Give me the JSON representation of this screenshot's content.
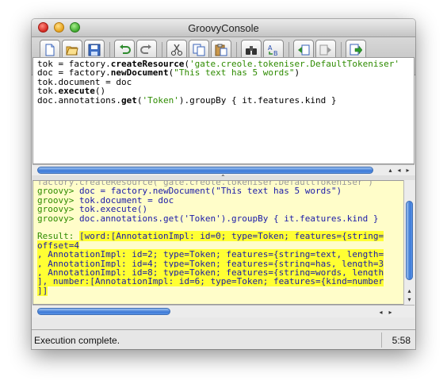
{
  "window": {
    "title": "GroovyConsole"
  },
  "toolbar": {
    "buttons": [
      {
        "name": "new-file-button",
        "icon": "new-file-icon"
      },
      {
        "name": "open-button",
        "icon": "open-folder-icon"
      },
      {
        "name": "save-button",
        "icon": "save-icon"
      },
      {
        "name": "undo-button",
        "icon": "undo-icon"
      },
      {
        "name": "redo-button",
        "icon": "redo-icon"
      },
      {
        "name": "cut-button",
        "icon": "cut-icon"
      },
      {
        "name": "copy-button",
        "icon": "copy-icon"
      },
      {
        "name": "paste-button",
        "icon": "paste-icon"
      },
      {
        "name": "find-button",
        "icon": "binoculars-icon"
      },
      {
        "name": "replace-button",
        "icon": "replace-icon"
      },
      {
        "name": "history-previous-button",
        "icon": "history-previous-icon"
      },
      {
        "name": "history-next-button",
        "icon": "history-next-icon"
      },
      {
        "name": "execute-button",
        "icon": "execute-icon"
      }
    ]
  },
  "editor": {
    "lines": [
      {
        "pre": "tok = factory.",
        "kw": "createResource",
        "post1": "(",
        "str": "'gate.creole.tokeniser.DefaultTokeniser'",
        "post2": ""
      },
      {
        "pre": "doc = factory.",
        "kw": "newDocument",
        "post1": "(",
        "str": "\"This text has 5 words\"",
        "post2": ")"
      },
      {
        "pre": "tok.document = doc",
        "kw": "",
        "post1": "",
        "str": "",
        "post2": ""
      },
      {
        "pre": "tok.",
        "kw": "execute",
        "post1": "()",
        "str": "",
        "post2": ""
      },
      {
        "pre": "doc.annotations.",
        "kw": "get",
        "post1": "(",
        "str": "'Token'",
        "post2": ").groupBy { it.features.kind }"
      }
    ]
  },
  "output": {
    "clipped_line": "factory.createResource('gate.creole.tokeniser.DefaultTokeniser')",
    "prompt": "groovy>",
    "commands": [
      "doc = factory.newDocument(\"This text has 5 words\")",
      "tok.document = doc",
      "tok.execute()",
      "doc.annotations.get('Token').groupBy { it.features.kind }"
    ],
    "result_label": "Result:",
    "result_lines": [
      "[word:[AnnotationImpl: id=0; type=Token; features={string=",
      "offset=4",
      ", AnnotationImpl: id=2; type=Token; features={string=text, length=",
      ", AnnotationImpl: id=4; type=Token; features={string=has, length=3",
      ", AnnotationImpl: id=8; type=Token; features={string=words, length",
      "], number:[AnnotationImpl: id=6; type=Token; features={kind=number",
      "]]"
    ]
  },
  "status": {
    "message": "Execution complete.",
    "position": "5:58"
  }
}
